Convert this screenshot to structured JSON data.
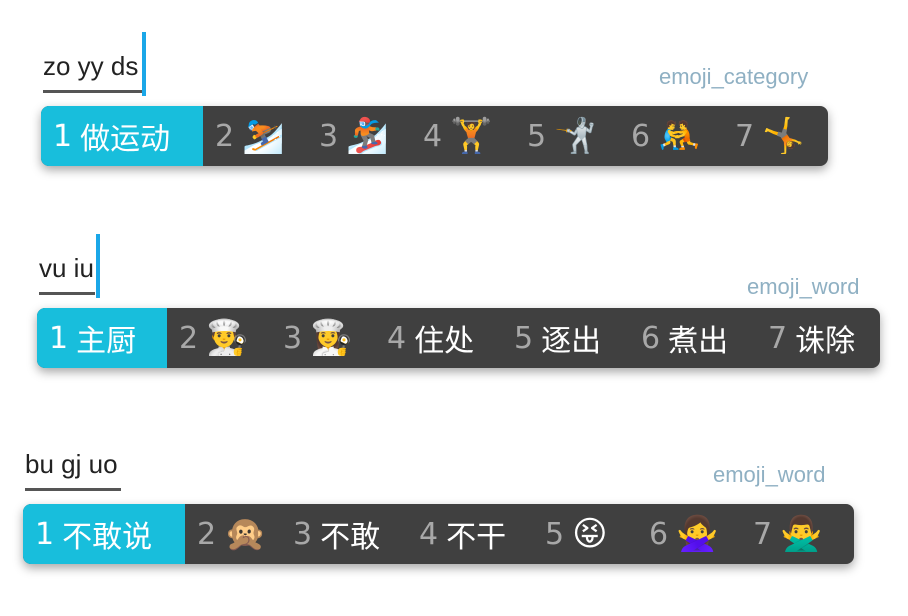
{
  "rows": [
    {
      "input": "zo yy ds",
      "tag": "emoji_category",
      "candidates": [
        {
          "num": "1",
          "text": "做运动"
        },
        {
          "num": "2",
          "text": "⛷️"
        },
        {
          "num": "3",
          "text": "🏂"
        },
        {
          "num": "4",
          "text": "🏋️"
        },
        {
          "num": "5",
          "text": "🤺"
        },
        {
          "num": "6",
          "text": "🤼"
        },
        {
          "num": "7",
          "text": "🤸"
        }
      ]
    },
    {
      "input": "vu iu",
      "tag": "emoji_word",
      "candidates": [
        {
          "num": "1",
          "text": "主厨"
        },
        {
          "num": "2",
          "text": "👨‍🍳"
        },
        {
          "num": "3",
          "text": "👩‍🍳"
        },
        {
          "num": "4",
          "text": "住处"
        },
        {
          "num": "5",
          "text": "逐出"
        },
        {
          "num": "6",
          "text": "煮出"
        },
        {
          "num": "7",
          "text": "诛除"
        }
      ]
    },
    {
      "input": "bu gj uo",
      "tag": "emoji_word",
      "candidates": [
        {
          "num": "1",
          "text": "不敢说"
        },
        {
          "num": "2",
          "text": "🙊"
        },
        {
          "num": "3",
          "text": "不敢"
        },
        {
          "num": "4",
          "text": "不干"
        },
        {
          "num": "5",
          "text": "😝"
        },
        {
          "num": "6",
          "text": "🙅‍♀️"
        },
        {
          "num": "7",
          "text": "🙅‍♂️"
        }
      ]
    }
  ],
  "colors": {
    "bar_bg": "#404040",
    "selected_bg": "#18bedc",
    "caret": "#1aa7e8",
    "tag_text": "#8fb0c3"
  }
}
